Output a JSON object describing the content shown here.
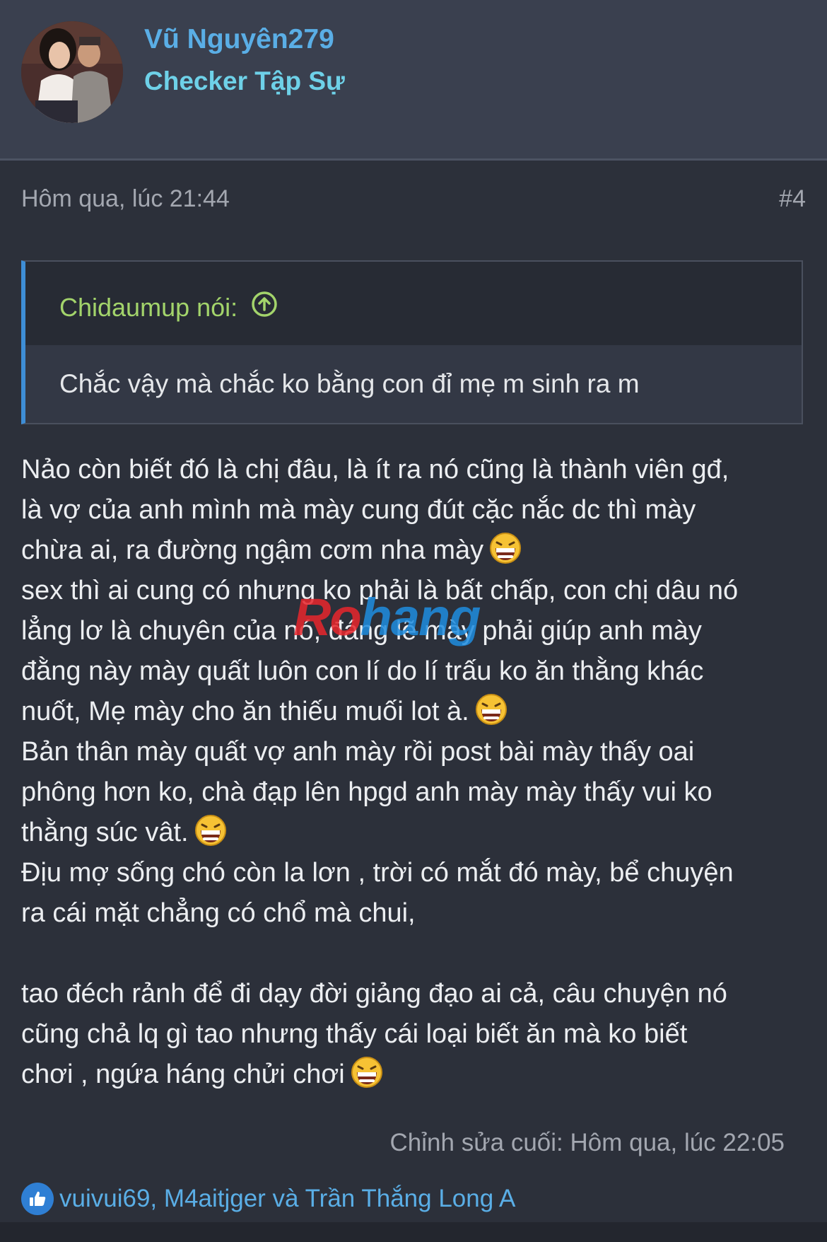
{
  "author": {
    "name": "Vũ Nguyên279",
    "title": "Checker Tập Sự"
  },
  "post": {
    "time": "Hôm qua, lúc 21:44",
    "number": "#4"
  },
  "quote": {
    "author_label": "Chidaumup nói:",
    "text": "Chắc vậy mà chắc ko bằng con đỉ mẹ m sinh ra m"
  },
  "body": {
    "l1": "Nảo còn biết đó là chị đâu, là ít ra nó cũng là thành viên gđ,",
    "l2": "là vợ của anh mình mà mày cung đút cặc nắc dc thì mày",
    "l3": "chừa ai, ra đường ngậm cơm nha mày",
    "l4": "sex thì ai cung có nhưng ko phải là bất chấp, con chị dâu nó",
    "l5": "lẳng lơ là chuyên của nó, đáng lẽ mày phải giúp anh mày",
    "l6": "đằng này mày quất luôn con lí do lí trấu ko ăn thằng khác",
    "l7": "nuốt, Mẹ mày cho ăn thiếu muối lot à.",
    "l8": "Bản thân mày quất vợ anh mày rồi post bài mày thấy oai",
    "l9": "phông hơn ko, chà đạp lên hpgd anh mày mày thấy vui ko",
    "l10": "thằng súc vât.",
    "l11": "Địu mợ sống chó còn la lơn , trời có mắt đó mày, bể chuyện",
    "l12": "ra cái mặt chẳng có chổ mà chui,",
    "l13": "tao đéch rảnh để đi dạy đời giảng đạo ai cả, câu chuyện nó",
    "l14": "cũng chả lq gì tao nhưng thấy cái loại biết ăn mà ko biết",
    "l15": "chơi , ngứa háng chửi chơi"
  },
  "watermark": {
    "part1": "Ro",
    "part2": "hang"
  },
  "edited": "Chỉnh sửa cuối: Hôm qua, lúc 22:05",
  "reactions": {
    "names": "vuivui69, M4aitjger và Trần Thắng Long A"
  },
  "colors": {
    "link": "#5aaee6",
    "quote_author": "#a3d46b",
    "quote_border": "#3e8ed6"
  }
}
